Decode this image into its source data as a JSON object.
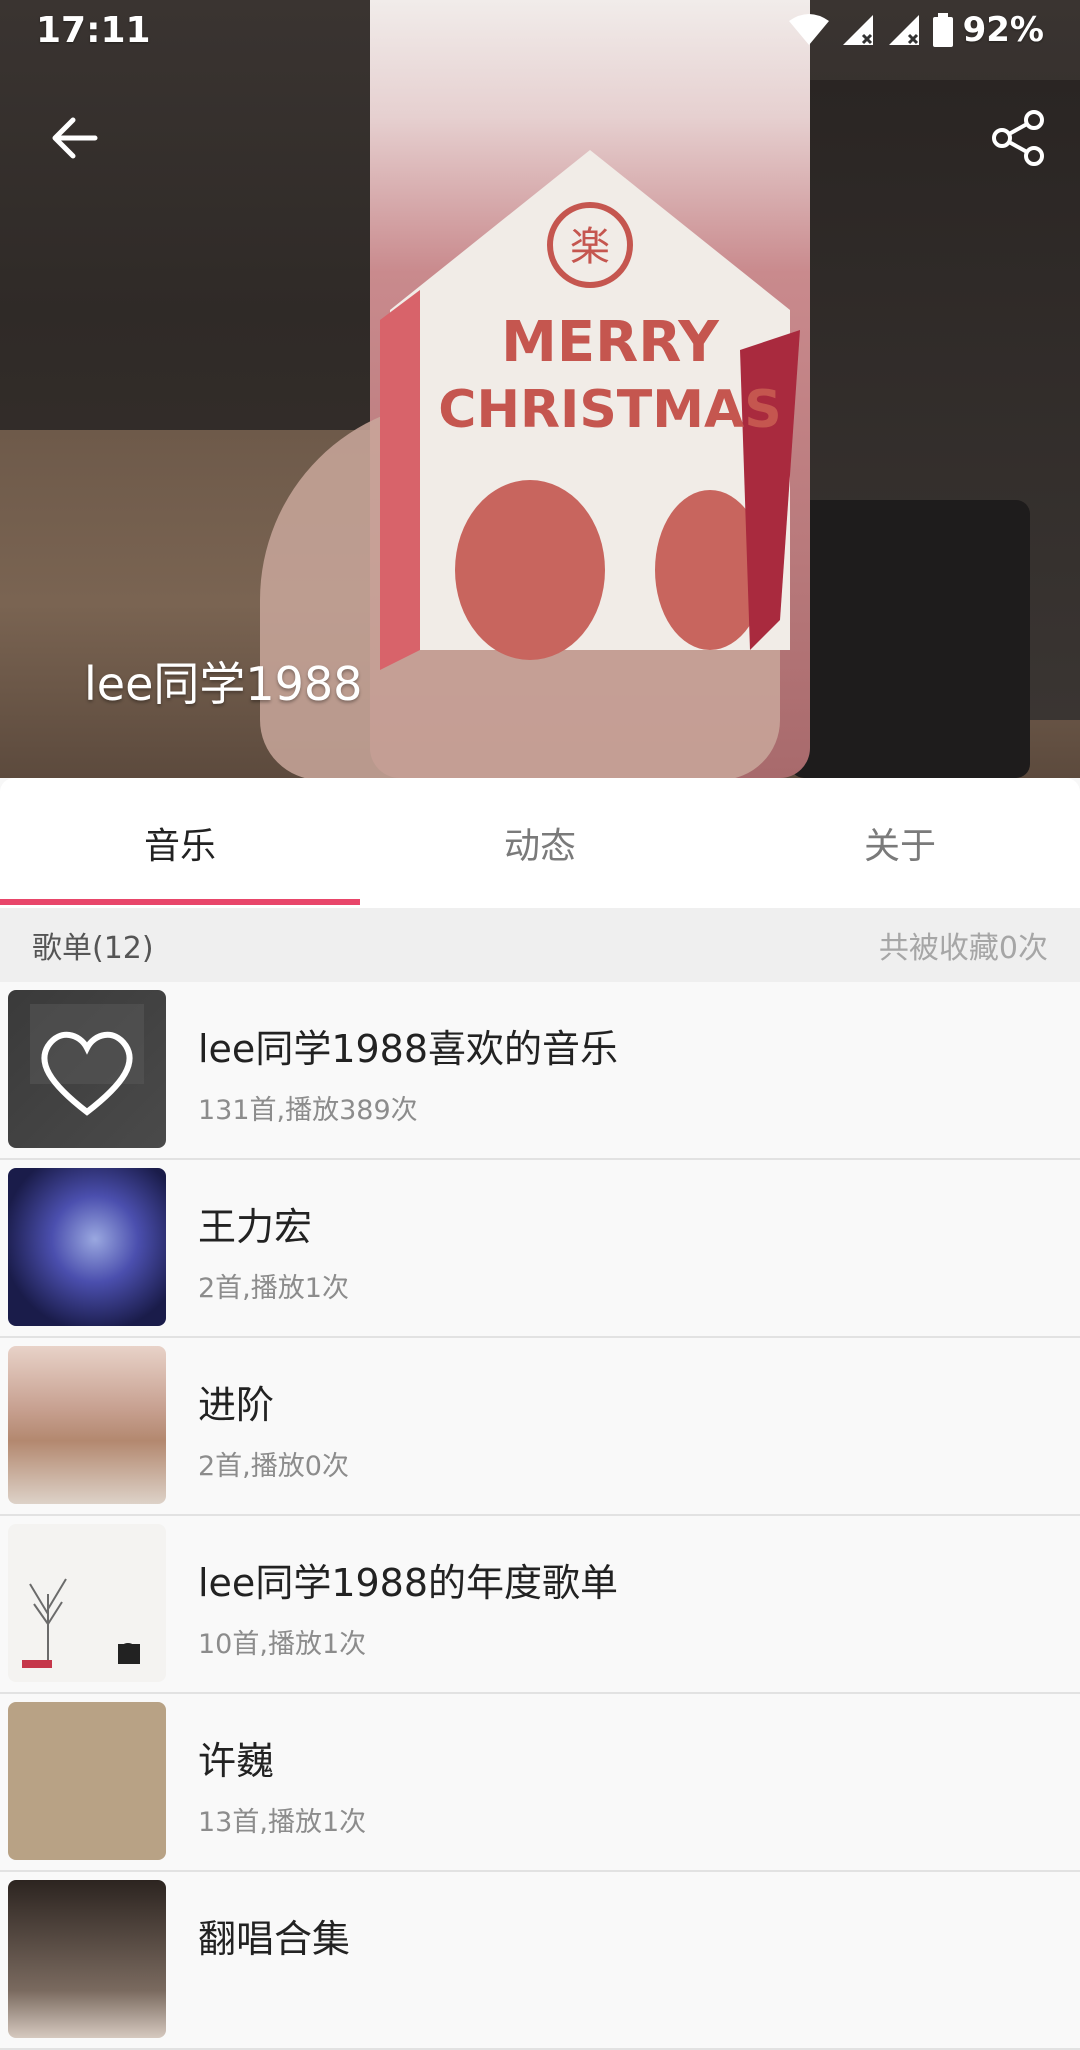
{
  "status_bar": {
    "time": "17:11",
    "battery": "92%"
  },
  "header": {
    "profile_name": "lee同学1988",
    "cover_text_line1": "MERRY",
    "cover_text_line2": "CHRISTMAS"
  },
  "tabs": [
    {
      "label": "音乐",
      "active": true
    },
    {
      "label": "动态",
      "active": false
    },
    {
      "label": "关于",
      "active": false
    }
  ],
  "section": {
    "title": "歌单(12)",
    "meta": "共被收藏0次"
  },
  "playlists": [
    {
      "title": "lee同学1988喜欢的音乐",
      "subtitle": "131首,播放389次"
    },
    {
      "title": "王力宏",
      "subtitle": "2首,播放1次"
    },
    {
      "title": "进阶",
      "subtitle": "2首,播放0次"
    },
    {
      "title": "lee同学1988的年度歌单",
      "subtitle": "10首,播放1次"
    },
    {
      "title": "许巍",
      "subtitle": "13首,播放1次"
    },
    {
      "title": "翻唱合集",
      "subtitle": ""
    }
  ],
  "colors": {
    "accent": "#e8466a"
  }
}
